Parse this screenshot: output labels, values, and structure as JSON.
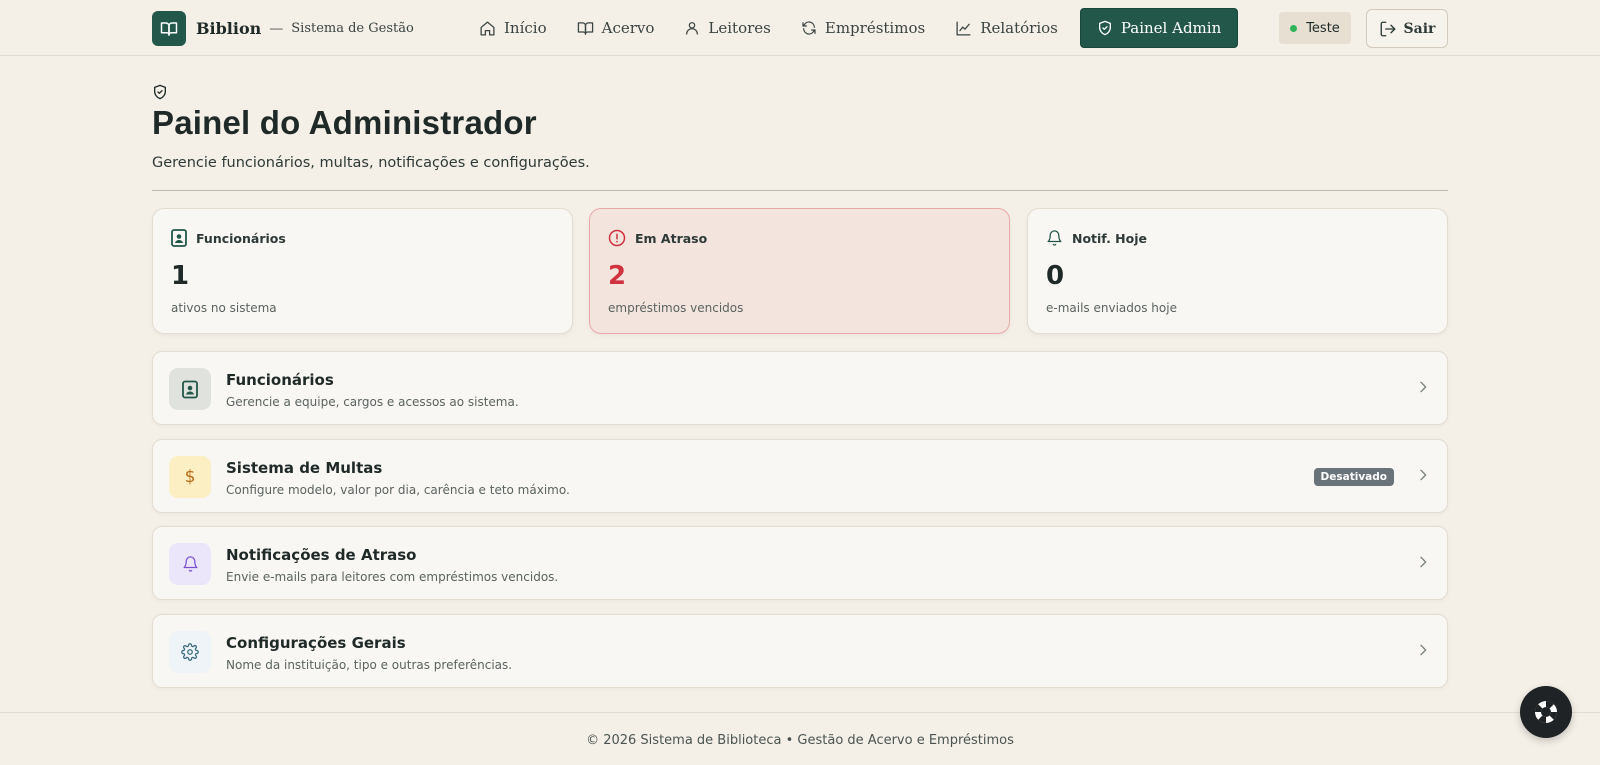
{
  "header": {
    "brand_name": "Biblion",
    "brand_separator": "—",
    "brand_subtitle": "Sistema de Gestão",
    "nav": [
      {
        "label": "Início",
        "icon": "home-icon"
      },
      {
        "label": "Acervo",
        "icon": "book-icon"
      },
      {
        "label": "Leitores",
        "icon": "user-icon"
      },
      {
        "label": "Empréstimos",
        "icon": "refresh-icon"
      },
      {
        "label": "Relatórios",
        "icon": "chart-line-icon"
      },
      {
        "label": "Painel Admin",
        "icon": "shield-check-icon",
        "active": true
      }
    ],
    "user_label": "Teste",
    "logout_label": "Sair"
  },
  "page": {
    "title": "Painel do Administrador",
    "subtitle": "Gerencie funcionários, multas, notificações e configurações."
  },
  "stats": [
    {
      "label": "Funcionários",
      "value": "1",
      "description": "ativos no sistema",
      "icon": "id-badge-icon"
    },
    {
      "label": "Em Atraso",
      "value": "2",
      "description": "empréstimos vencidos",
      "icon": "alert-circle-icon",
      "alert": true
    },
    {
      "label": "Notif. Hoje",
      "value": "0",
      "description": "e-mails enviados hoje",
      "icon": "bell-icon"
    }
  ],
  "sections": [
    {
      "title": "Funcionários",
      "description": "Gerencie a equipe, cargos e acessos ao sistema.",
      "icon": "id-badge-icon"
    },
    {
      "title": "Sistema de Multas",
      "description": "Configure modelo, valor por dia, carência e teto máximo.",
      "icon": "dollar-icon",
      "badge": "Desativado"
    },
    {
      "title": "Notificações de Atraso",
      "description": "Envie e-mails para leitores com empréstimos vencidos.",
      "icon": "bell-icon"
    },
    {
      "title": "Configurações Gerais",
      "description": "Nome da instituição, tipo e outras preferências.",
      "icon": "gear-icon"
    }
  ],
  "footer": {
    "text": "© 2026 Sistema de Biblioteca • Gestão de Acervo e Empréstimos"
  },
  "colors": {
    "brand": "#22574a",
    "background": "#f4efe7",
    "alert": "#d1323f",
    "status_online": "#2fb35a"
  }
}
